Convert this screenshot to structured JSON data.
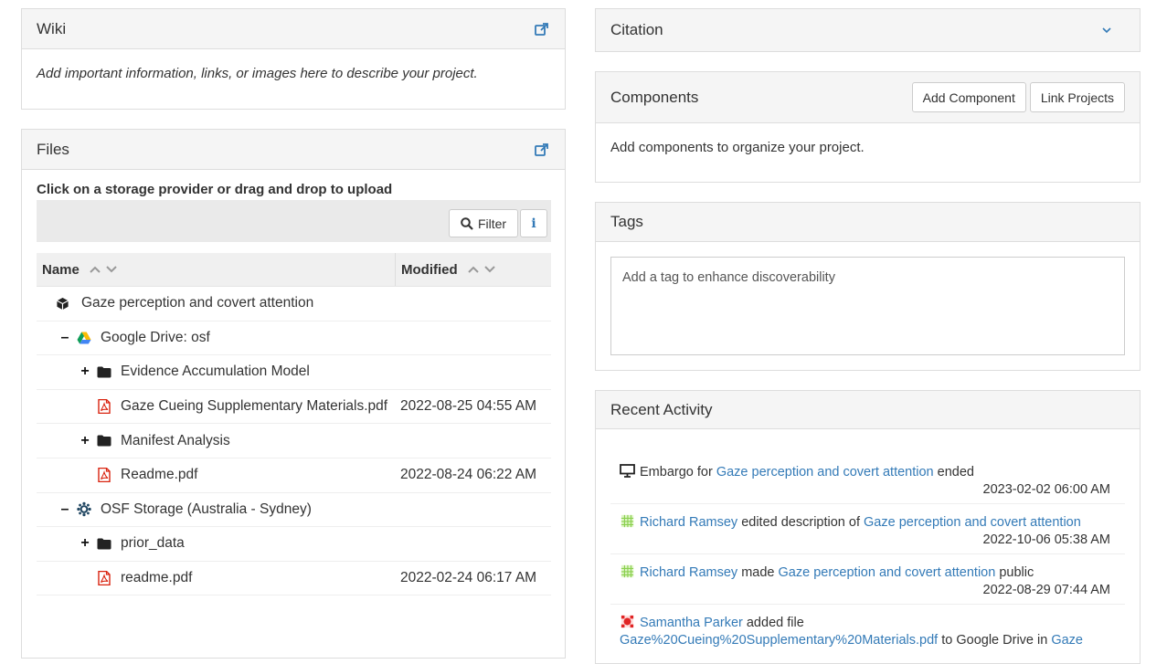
{
  "wiki": {
    "title": "Wiki",
    "body": "Add important information, links, or images here to describe your project."
  },
  "files": {
    "title": "Files",
    "upload_hint": "Click on a storage provider or drag and drop to upload",
    "filter_label": "Filter",
    "info_label": "i",
    "columns": {
      "name": "Name",
      "modified": "Modified"
    },
    "rows": [
      {
        "toggle": "",
        "icon": "project-cube-icon",
        "name": "Gaze perception and covert attention",
        "modified": ""
      },
      {
        "toggle": "–",
        "icon": "google-drive-icon",
        "name": "Google Drive: osf",
        "modified": ""
      },
      {
        "toggle": "+",
        "icon": "folder-icon",
        "name": "Evidence Accumulation Model",
        "modified": ""
      },
      {
        "toggle": "",
        "icon": "pdf-file-icon",
        "name": "Gaze Cueing Supplementary Materials.pdf",
        "modified": "2022-08-25 04:55 AM"
      },
      {
        "toggle": "+",
        "icon": "folder-icon",
        "name": "Manifest Analysis",
        "modified": ""
      },
      {
        "toggle": "",
        "icon": "pdf-file-icon",
        "name": "Readme.pdf",
        "modified": "2022-08-24 06:22 AM"
      },
      {
        "toggle": "–",
        "icon": "osf-storage-icon",
        "name": "OSF Storage (Australia - Sydney)",
        "modified": ""
      },
      {
        "toggle": "+",
        "icon": "folder-icon",
        "name": "prior_data",
        "modified": ""
      },
      {
        "toggle": "",
        "icon": "pdf-file-icon",
        "name": "readme.pdf",
        "modified": "2022-02-24 06:17 AM"
      }
    ]
  },
  "citation": {
    "title": "Citation"
  },
  "components": {
    "title": "Components",
    "add_button": "Add Component",
    "link_button": "Link Projects",
    "body": "Add components to organize your project."
  },
  "tags": {
    "title": "Tags",
    "placeholder": "Add a tag to enhance discoverability"
  },
  "activity": {
    "title": "Recent Activity",
    "items": [
      {
        "pre": "Embargo for ",
        "link1": "Gaze perception and covert attention",
        "mid": " ended",
        "link2": "",
        "post": "",
        "time": "2023-02-02 06:00 AM"
      },
      {
        "user": "Richard Ramsey",
        "mid": " edited description of ",
        "link": "Gaze perception and covert attention",
        "time": "2022-10-06 05:38 AM"
      },
      {
        "user": "Richard Ramsey",
        "mid": " made ",
        "link": "Gaze perception and covert attention",
        "post": " public",
        "time": "2022-08-29 07:44 AM"
      },
      {
        "user": "Samantha Parker",
        "mid": " added file",
        "file": "Gaze%20Cueing%20Supplementary%20Materials.pdf",
        "post": " to Google Drive in ",
        "link": "Gaze"
      }
    ]
  },
  "colors": {
    "link": "#337ab7",
    "panel_heading_bg": "#f5f5f5",
    "border": "#dddddd",
    "pdf_red": "#d9230f"
  }
}
